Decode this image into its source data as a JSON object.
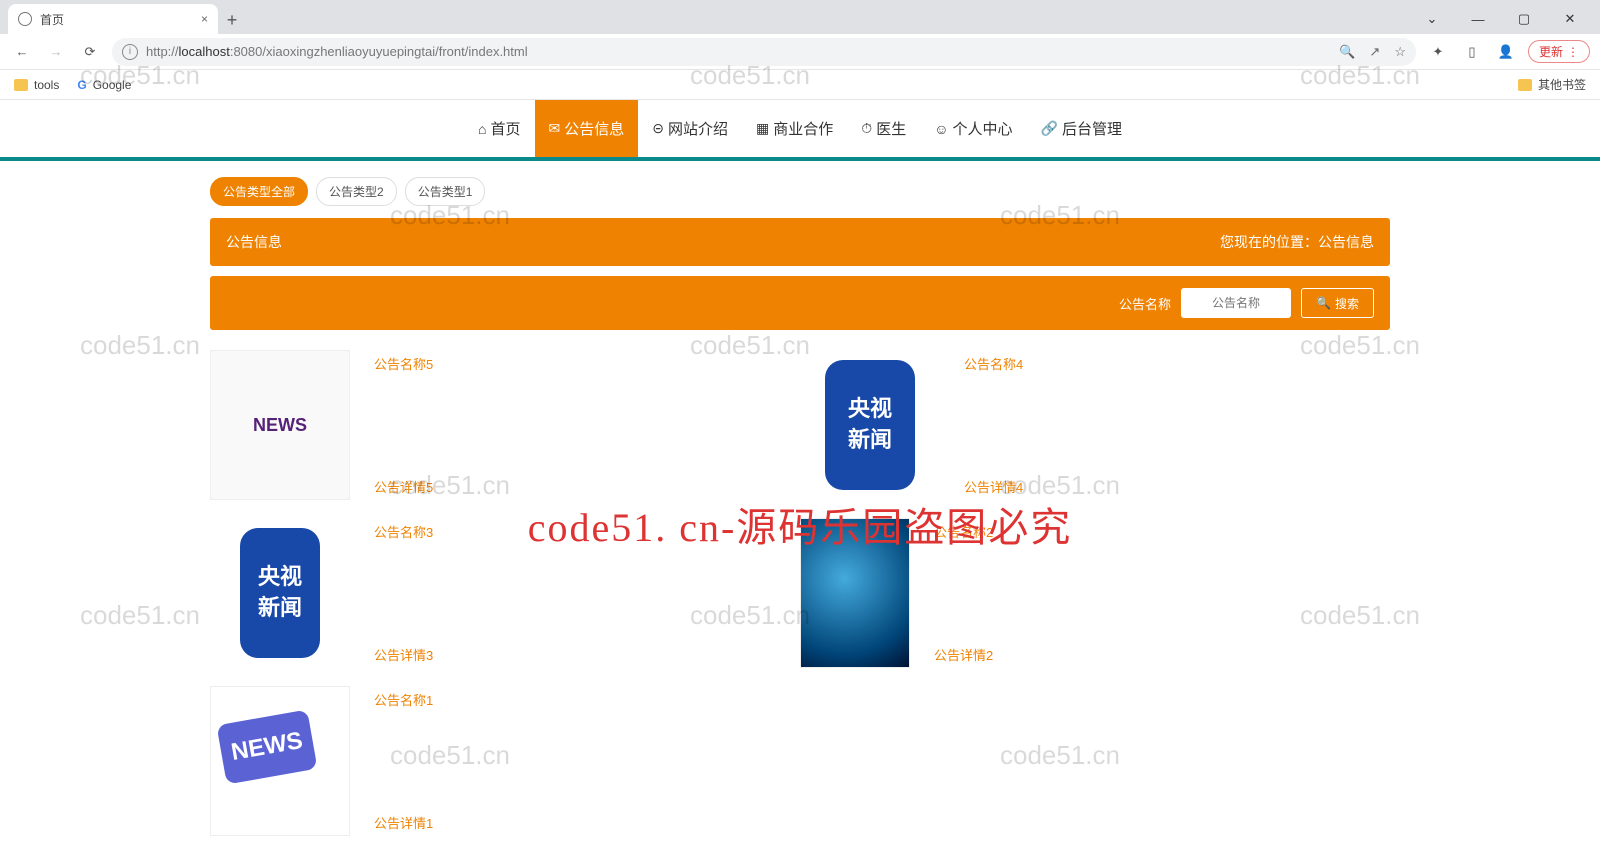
{
  "browser": {
    "tab_title": "首页",
    "url_display_prefix": "http://",
    "url_host": "localhost",
    "url_port": ":8080",
    "url_path": "/xiaoxingzhenliaoyuyuepingtai/front/index.html",
    "update_label": "更新",
    "bookmarks": {
      "tools": "tools",
      "google": "Google",
      "other": "其他书签"
    }
  },
  "nav": {
    "items": [
      {
        "label": "首页",
        "icon": "⌂"
      },
      {
        "label": "公告信息",
        "icon": "✉"
      },
      {
        "label": "网站介绍",
        "icon": "⊝"
      },
      {
        "label": "商业合作",
        "icon": "▦"
      },
      {
        "label": "医生",
        "icon": "⏱"
      },
      {
        "label": "个人中心",
        "icon": "☺"
      },
      {
        "label": "后台管理",
        "icon": "🔗"
      }
    ],
    "active_index": 1
  },
  "filters": {
    "pills": [
      "公告类型全部",
      "公告类型2",
      "公告类型1"
    ],
    "active_index": 0
  },
  "banner": {
    "title": "公告信息",
    "crumb_prefix": "您现在的位置：",
    "crumb_current": "公告信息"
  },
  "search": {
    "label": "公告名称",
    "placeholder": "公告名称",
    "button": "搜索"
  },
  "items": [
    {
      "title": "公告名称5",
      "detail": "公告详情5",
      "thumb": "news"
    },
    {
      "title": "公告名称4",
      "detail": "公告详情4",
      "thumb": "cctv"
    },
    {
      "title": "公告名称3",
      "detail": "公告详情3",
      "thumb": "cctv"
    },
    {
      "title": "公告名称2",
      "detail": "公告详情2",
      "thumb": "globe"
    },
    {
      "title": "公告名称1",
      "detail": "公告详情1",
      "thumb": "newsblue"
    }
  ],
  "watermark": {
    "grey": "code51.cn",
    "red": "code51. cn-源码乐园盗图必究"
  }
}
